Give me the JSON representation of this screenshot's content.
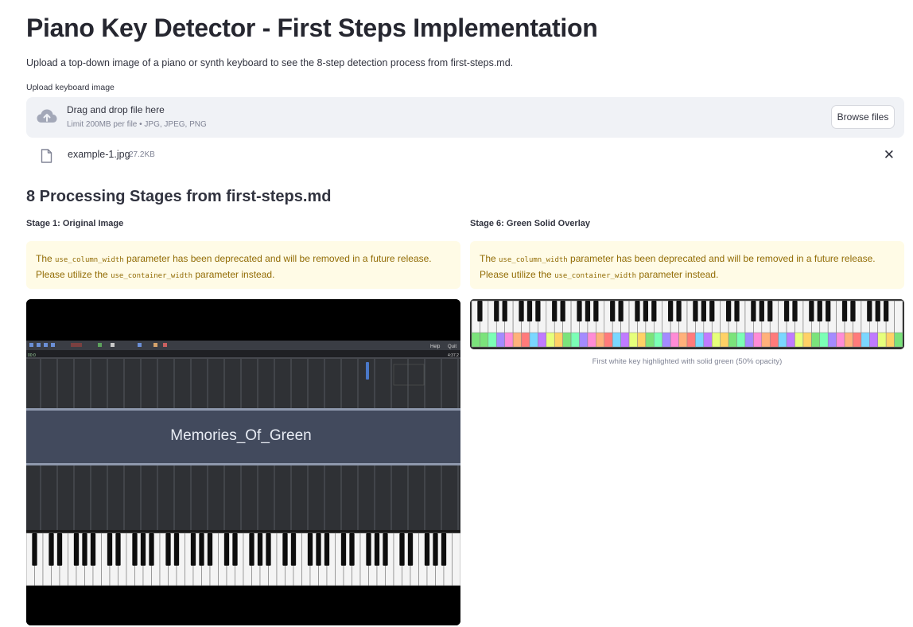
{
  "header": {
    "title": "Piano Key Detector - First Steps Implementation",
    "subtitle": "Upload a top-down image of a piano or synth keyboard to see the 8-step detection process from first-steps.md."
  },
  "uploader": {
    "label": "Upload keyboard image",
    "drop_text": "Drag and drop file here",
    "limit_text": "Limit 200MB per file • JPG, JPEG, PNG",
    "browse_label": "Browse files",
    "cloud_icon": "cloud-upload-icon",
    "file_icon": "file-icon",
    "close_icon": "close-icon",
    "close_glyph": "✕",
    "file": {
      "name": "example-1.jpg",
      "size": "27.2KB"
    }
  },
  "section": {
    "heading": "8 Processing Stages from first-steps.md"
  },
  "stages": {
    "left": {
      "title": "Stage 1: Original Image"
    },
    "right": {
      "title": "Stage 6: Green Solid Overlay",
      "caption": "First white key highlighted with solid green (50% opacity)"
    }
  },
  "warning": {
    "part1": "The ",
    "code1": "use_column_width",
    "part2": " parameter has been deprecated and will be removed in a future release. Please utilize the ",
    "code2": "use_container_width",
    "part3": " parameter instead."
  },
  "screenshot": {
    "song_title": "Memories_Of_Green",
    "help_label": "Help",
    "quit_label": "Quit",
    "time_left": "00:0",
    "time_right": "4:37.2"
  },
  "colors": {
    "warning_bg": "#fffbe6",
    "warning_text": "#926c05",
    "dropzone_bg": "#f0f2f6",
    "overlay_palette": [
      "#7be37b",
      "#ff8bd6",
      "#7ad7ff",
      "#ffd166",
      "#a48bff",
      "#ff7b7b",
      "#e6ff7b",
      "#7bffb5",
      "#ffb17b",
      "#c07bff"
    ]
  }
}
